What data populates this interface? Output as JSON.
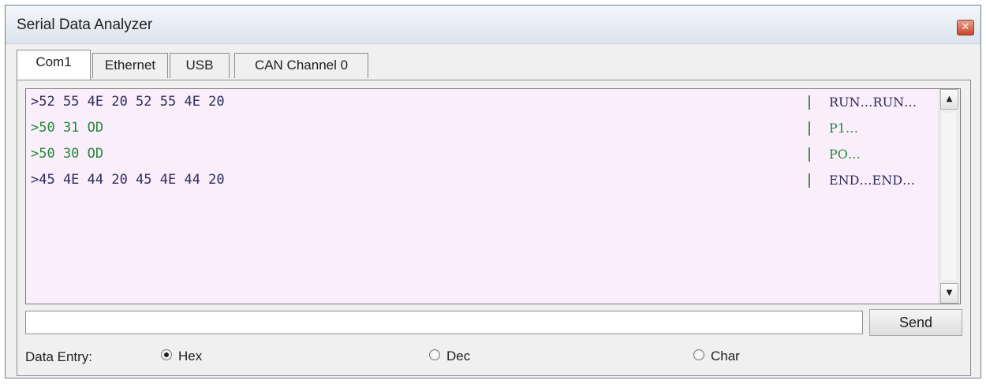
{
  "window": {
    "title": "Serial Data Analyzer",
    "close_glyph": "✕",
    "close_icon": "close-icon"
  },
  "tabs": [
    {
      "label": "Com1",
      "selected": true
    },
    {
      "label": "Ethernet",
      "selected": false
    },
    {
      "label": "USB",
      "selected": false
    },
    {
      "label": "CAN Channel 0",
      "selected": false
    }
  ],
  "console": {
    "lines": [
      {
        "hex": ">52 55 4E 20 52 55 4E 20",
        "ascii": "RUN…RUN…",
        "color": "#2c2c5c"
      },
      {
        "hex": ">50 31 OD",
        "ascii": "P1…",
        "color": "#1f8a3a"
      },
      {
        "hex": ">50 30 OD",
        "ascii": "PO…",
        "color": "#1f8a3a"
      },
      {
        "hex": ">45 4E 44 20 45 4E 44 20",
        "ascii": "END…END…",
        "color": "#2c2c5c"
      }
    ],
    "scroll_up_glyph": "▲",
    "scroll_down_glyph": "▼"
  },
  "send": {
    "input_value": "",
    "button_label": "Send"
  },
  "data_entry": {
    "label": "Data Entry:",
    "options": [
      "Hex",
      "Dec",
      "Char"
    ],
    "selected": "Hex"
  },
  "colors": {
    "console_background": "#fbeefb",
    "incoming_text": "#2c2c5c",
    "outgoing_text": "#1f8a3a"
  }
}
